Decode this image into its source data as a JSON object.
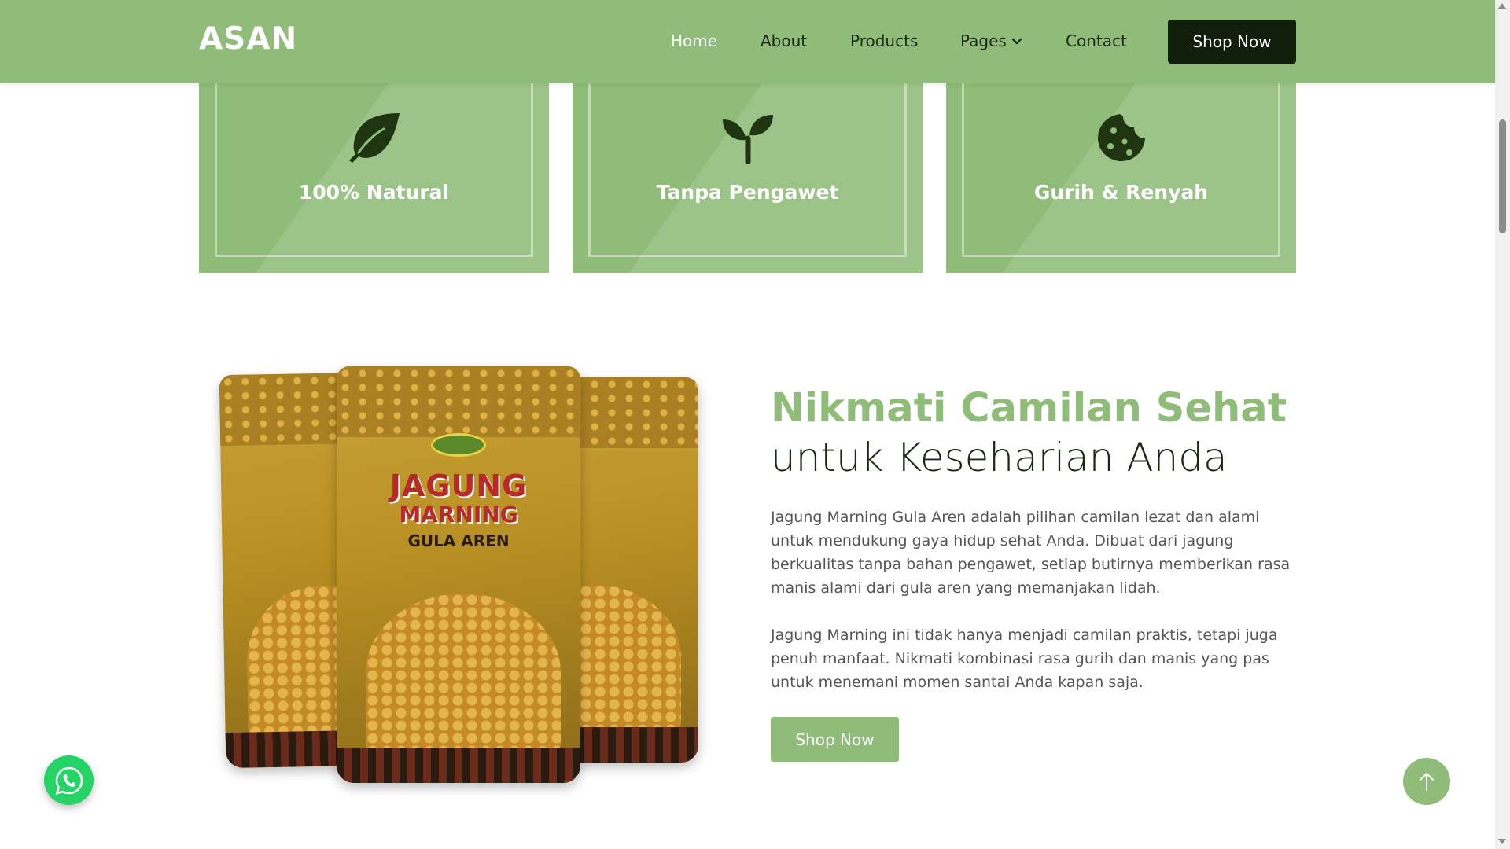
{
  "brand": {
    "logo": "ASAN"
  },
  "nav": {
    "items": [
      {
        "label": "Home",
        "active": true
      },
      {
        "label": "About"
      },
      {
        "label": "Products"
      },
      {
        "label": "Pages"
      },
      {
        "label": "Contact"
      }
    ],
    "cta_label": "Shop Now"
  },
  "features": [
    {
      "icon": "leaf-icon",
      "title": "100% Natural"
    },
    {
      "icon": "sprout-icon",
      "title": "Tanpa Pengawet"
    },
    {
      "icon": "cookie-icon",
      "title": "Gurih & Renyah"
    }
  ],
  "about": {
    "headline_accent": "Nikmati Camilan Sehat",
    "headline_rest": "untuk Keseharian Anda",
    "paragraph_1": "Jagung Marning Gula Aren adalah pilihan camilan lezat dan alami untuk mendukung gaya hidup sehat Anda. Dibuat dari jagung berkualitas tanpa bahan pengawet, setiap butirnya memberikan rasa manis alami dari gula aren yang memanjakan lidah.",
    "paragraph_2": "Jagung Marning ini tidak hanya menjadi camilan praktis, tetapi juga penuh manfaat. Nikmati kombinasi rasa gurih dan manis yang pas untuk menemani momen santai Anda kapan saja.",
    "cta_label": "Shop Now"
  },
  "product_pack": {
    "line1": "JAGUNG",
    "line2": "MARNING",
    "line3": "GULA AREN"
  },
  "floating": {
    "whatsapp_icon": "whatsapp-icon",
    "scroll_top_icon": "arrow-up-icon"
  },
  "colors": {
    "accent": "#8fbc78",
    "dark": "#0f1f0b",
    "whatsapp": "#25d366"
  }
}
